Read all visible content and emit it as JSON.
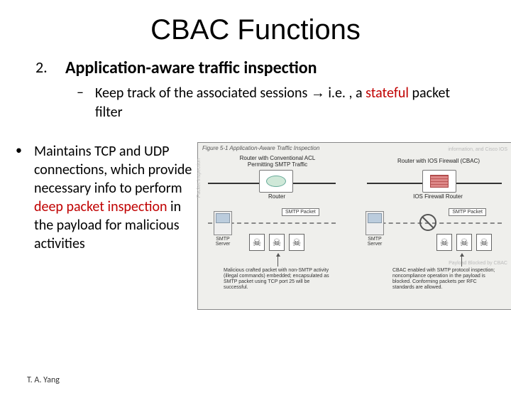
{
  "title": "CBAC Functions",
  "item_number": "2.",
  "heading2": "Application-aware traffic inspection",
  "dash": "–",
  "sub_prefix": "Keep track of the associated sessions ",
  "sub_arrow": "→",
  "sub_mid": " i.e. , a ",
  "sub_stateful": "stateful",
  "sub_suffix": " packet filter",
  "dot": "•",
  "para_prefix": "Maintains TCP and UDP connections, which provide necessary info to perform ",
  "para_deep": "deep packet inspection",
  "para_suffix": " in the payload for malicious activities",
  "figure": {
    "caption": "Figure 5-1   Application-Aware Traffic Inspection",
    "left_title_l1": "Router with Conventional ACL",
    "left_title_l2": "Permitting SMTP Traffic",
    "right_title": "Router with IOS Firewall (CBAC)",
    "router": "Router",
    "ios_fw": "IOS Firewall Router",
    "smtp_server": "SMTP\nServer",
    "smtp_packet": "SMTP Packet",
    "ghost1": "Packet Inspection",
    "ghost2": "information, and Cisco IOS",
    "ghost3": "Payload Blocked by CBAC",
    "left_cap": "Malicious crafted packet with non-SMTP activity (illegal commands) embedded; encapsulated as SMTP packet using TCP port 25 will be successful.",
    "right_cap": "CBAC enabled with SMTP protocol inspection; noncompliance operation in the payload is blocked. Conforming packets per RFC standards are allowed."
  },
  "footer": "T. A. Yang"
}
